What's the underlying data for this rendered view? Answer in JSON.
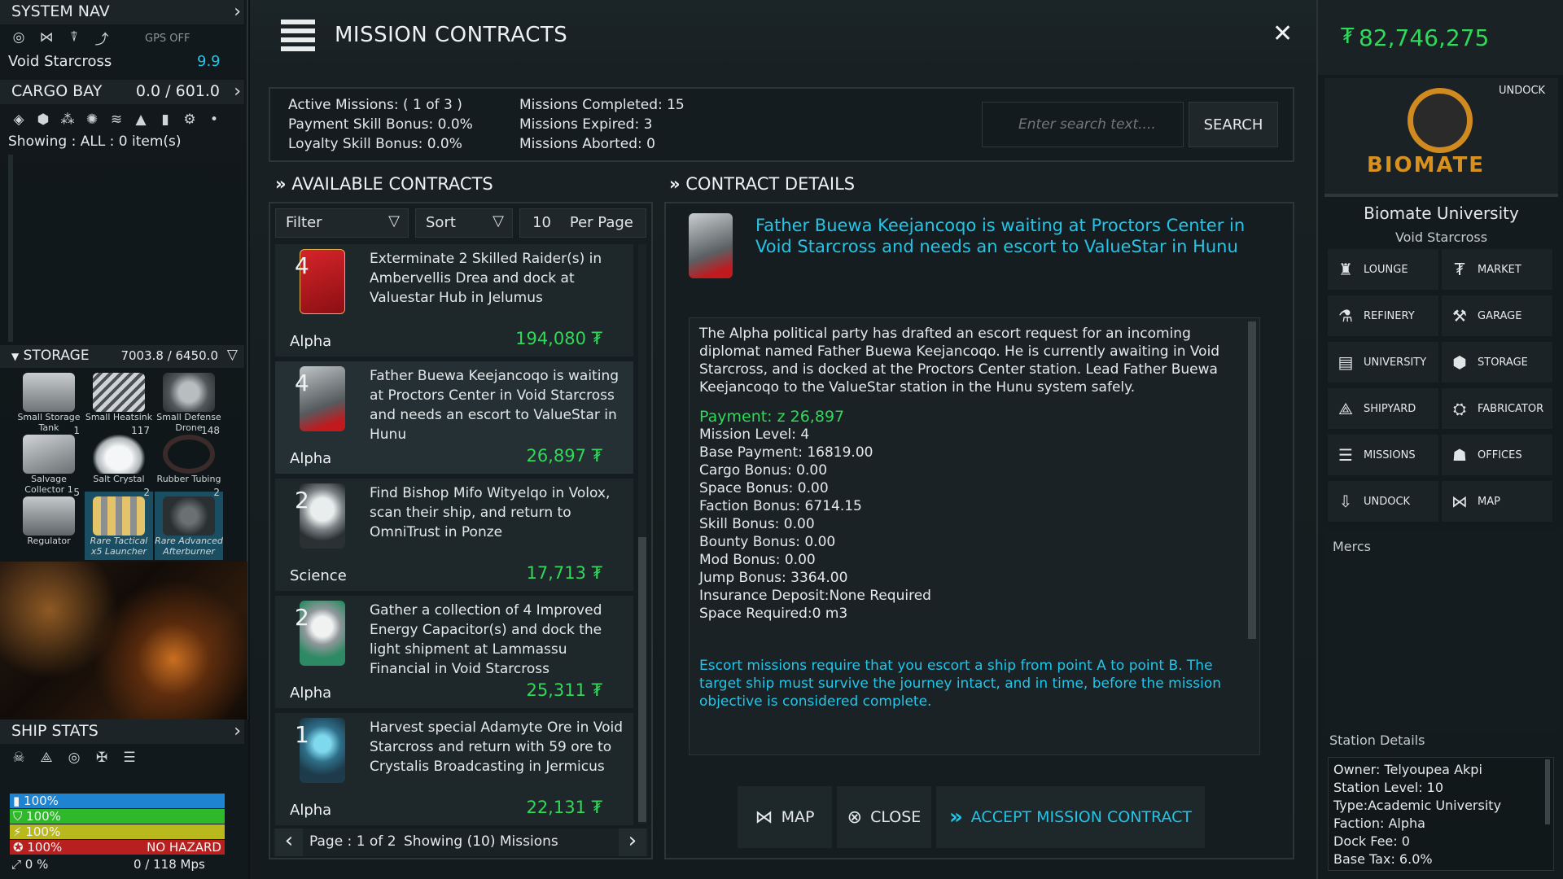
{
  "system_nav": {
    "header": "SYSTEM NAV",
    "gps": "GPS OFF",
    "location": "Void Starcross",
    "security": "9.9"
  },
  "cargo": {
    "header": "CARGO BAY",
    "capacity": "0.0 / 601.0",
    "showing": "Showing : ALL : 0 item(s)"
  },
  "storage": {
    "header": "STORAGE",
    "capacity": "7003.8 / 6450.0",
    "items": [
      {
        "name": "Small Storage Tank",
        "count": ""
      },
      {
        "name": "Small Heatsink",
        "count": ""
      },
      {
        "name": "Small Defense Drone",
        "count": ""
      },
      {
        "name": "Salvage Collector 1",
        "count": "1"
      },
      {
        "name": "Salt Crystal",
        "count": "117"
      },
      {
        "name": "Rubber Tubing",
        "count": "148"
      },
      {
        "name": "Regulator",
        "count": "5"
      },
      {
        "name": "Rare Tactical x5 Launcher",
        "count": "2"
      },
      {
        "name": "Rare Advanced Afterburner",
        "count": "2"
      }
    ]
  },
  "ship_stats": {
    "header": "SHIP STATS",
    "shield": "100%",
    "armor": "100%",
    "energy": "100%",
    "hull": "100%",
    "hazard": "NO HAZARD",
    "speed_pct": "0 %",
    "speed": "0  /  118 Mps"
  },
  "main": {
    "title": "MISSION CONTRACTS",
    "active": "Active Missions: ( 1 of 3 )",
    "payment_bonus": "Payment Skill Bonus: 0.0%",
    "loyalty_bonus": "Loyalty Skill Bonus: 0.0%",
    "completed": "Missions Completed: 15",
    "expired": "Missions Expired: 3",
    "aborted": "Missions Aborted: 0",
    "search_placeholder": "Enter search text....",
    "search_button": "SEARCH"
  },
  "available": {
    "header": "AVAILABLE CONTRACTS",
    "filter": "Filter",
    "sort": "Sort",
    "per_page_num": "10",
    "per_page": "Per Page",
    "cards": [
      {
        "level": "4",
        "desc": "Exterminate 2 Skilled Raider(s) in Ambervellis Drea and dock at Valuestar Hub in Jelumus",
        "faction": "Alpha",
        "reward": "194,080",
        "color": "#c0181a"
      },
      {
        "level": "4",
        "desc": "Father Buewa Keejancoqo is waiting at Proctors Center in Void Starcross and needs an escort to ValueStar in Hunu",
        "faction": "Alpha",
        "reward": "26,897",
        "color": "#8a8f91"
      },
      {
        "level": "2",
        "desc": "Find Bishop Mifo Wityelqo in Volox, scan their ship, and return to OmniTrust in Ponze",
        "faction": "Science",
        "reward": "17,713",
        "color": "#9aa3a4"
      },
      {
        "level": "2",
        "desc": "Gather a collection of 4 Improved Energy Capacitor(s) and dock the light shipment at Lammassu Financial in Void Starcross",
        "faction": "Alpha",
        "reward": "25,311",
        "color": "#2e8a64"
      },
      {
        "level": "1",
        "desc": "Harvest special Adamyte Ore in Void Starcross and return with 59 ore to Crystalis Broadcasting in Jermicus",
        "faction": "Alpha",
        "reward": "22,131",
        "color": "#3c8ab0"
      }
    ],
    "page": "Page : 1 of 2",
    "showing": "Showing (10) Missions"
  },
  "details": {
    "header": "CONTRACT DETAILS",
    "headline": "Father Buewa Keejancoqo is waiting at Proctors Center in Void Starcross and needs an escort to ValueStar in Hunu",
    "body": "The Alpha political party has drafted an escort request for an incoming diplomat named Father Buewa Keejancoqo. He is currently awaiting in Void Starcross, and is docked at the Proctors Center station. Lead Father Buewa Keejancoqo to the ValueStar station in the Hunu system safely.",
    "payment": "Payment: z 26,897",
    "lines": [
      "Mission Level: 4",
      "Base Payment: 16819.00",
      "Cargo Bonus: 0.00",
      "Space Bonus: 0.00",
      "Faction Bonus: 6714.15",
      "Skill Bonus: 0.00",
      "Bounty Bonus: 0.00",
      "Mod Bonus: 0.00",
      "Jump Bonus: 3364.00",
      "Insurance Deposit:None Required",
      "Space Required:0 m3"
    ],
    "note": "Escort missions require that you escort a ship from point A to point B. The target ship must survive the journey intact, and in time, before the mission objective is considered complete.",
    "map_button": "MAP",
    "close_button": "CLOSE",
    "accept_button": "ACCEPT MISSION CONTRACT"
  },
  "right": {
    "credits": "82,746,275",
    "undock": "UNDOCK",
    "brand": "BIOMATE",
    "station_name": "Biomate University",
    "station_system": "Void Starcross",
    "services": [
      {
        "label": "LOUNGE",
        "icon": "lounge-icon"
      },
      {
        "label": "MARKET",
        "icon": "market-icon"
      },
      {
        "label": "REFINERY",
        "icon": "refinery-icon"
      },
      {
        "label": "GARAGE",
        "icon": "garage-icon"
      },
      {
        "label": "UNIVERSITY",
        "icon": "university-icon"
      },
      {
        "label": "STORAGE",
        "icon": "storage-icon"
      },
      {
        "label": "SHIPYARD",
        "icon": "shipyard-icon"
      },
      {
        "label": "FABRICATOR",
        "icon": "fabricator-icon"
      },
      {
        "label": "MISSIONS",
        "icon": "missions-icon"
      },
      {
        "label": "OFFICES",
        "icon": "offices-icon"
      },
      {
        "label": "UNDOCK",
        "icon": "undock-icon"
      },
      {
        "label": "MAP",
        "icon": "map-icon"
      }
    ],
    "mercs": "Mercs",
    "station_details_header": "Station Details",
    "station_details": [
      "Owner: Telyoupea Akpi",
      "Station Level: 10",
      "Type:Academic University",
      "Faction: Alpha",
      "Dock Fee: 0",
      "Base Tax: 6.0%"
    ]
  },
  "colors": {
    "accent_cyan": "#22c5e8",
    "reward_green": "#31d85a",
    "shield_blue": "#1e84d2",
    "armor_green": "#2fb82a",
    "energy_yellow": "#b9b81c",
    "hull_red": "#b81f1f"
  }
}
